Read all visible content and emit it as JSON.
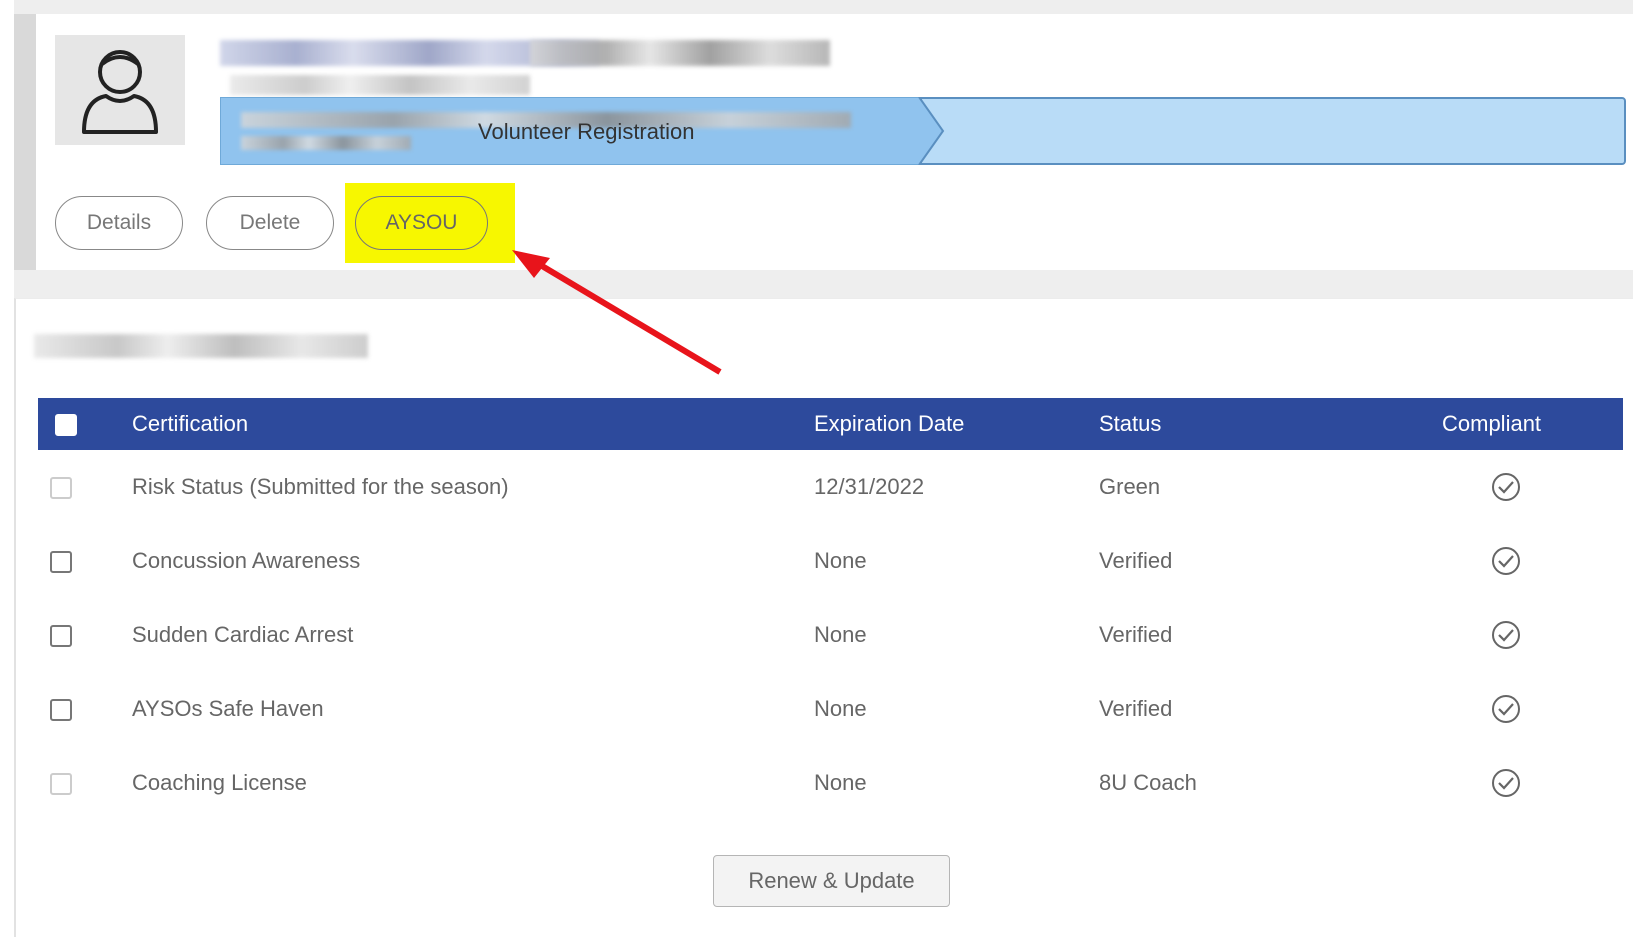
{
  "profile": {
    "avatar_icon": "user-icon",
    "breadcrumb_current": "Volunteer Registration"
  },
  "actions": {
    "details_label": "Details",
    "delete_label": "Delete",
    "aysou_label": "AYSOU",
    "highlight_color": "#f7f700",
    "annotation_arrow_color": "#e8141b"
  },
  "table": {
    "header_color": "#2d4a9c",
    "columns": {
      "certification": "Certification",
      "expiration": "Expiration Date",
      "status": "Status",
      "compliant": "Compliant"
    },
    "rows": [
      {
        "certification": "Risk Status (Submitted for the season)",
        "expiration": "12/31/2022",
        "status": "Green",
        "compliant_icon": "check-circle-icon",
        "checkbox_enabled": false
      },
      {
        "certification": "Concussion Awareness",
        "expiration": "None",
        "status": "Verified",
        "compliant_icon": "check-circle-icon",
        "checkbox_enabled": true
      },
      {
        "certification": "Sudden Cardiac Arrest",
        "expiration": "None",
        "status": "Verified",
        "compliant_icon": "check-circle-icon",
        "checkbox_enabled": true
      },
      {
        "certification": "AYSOs Safe Haven",
        "expiration": "None",
        "status": "Verified",
        "compliant_icon": "check-circle-icon",
        "checkbox_enabled": true
      },
      {
        "certification": "Coaching License",
        "expiration": "None",
        "status": "8U Coach",
        "compliant_icon": "check-circle-icon",
        "checkbox_enabled": false
      }
    ]
  },
  "renew_label": "Renew & Update"
}
